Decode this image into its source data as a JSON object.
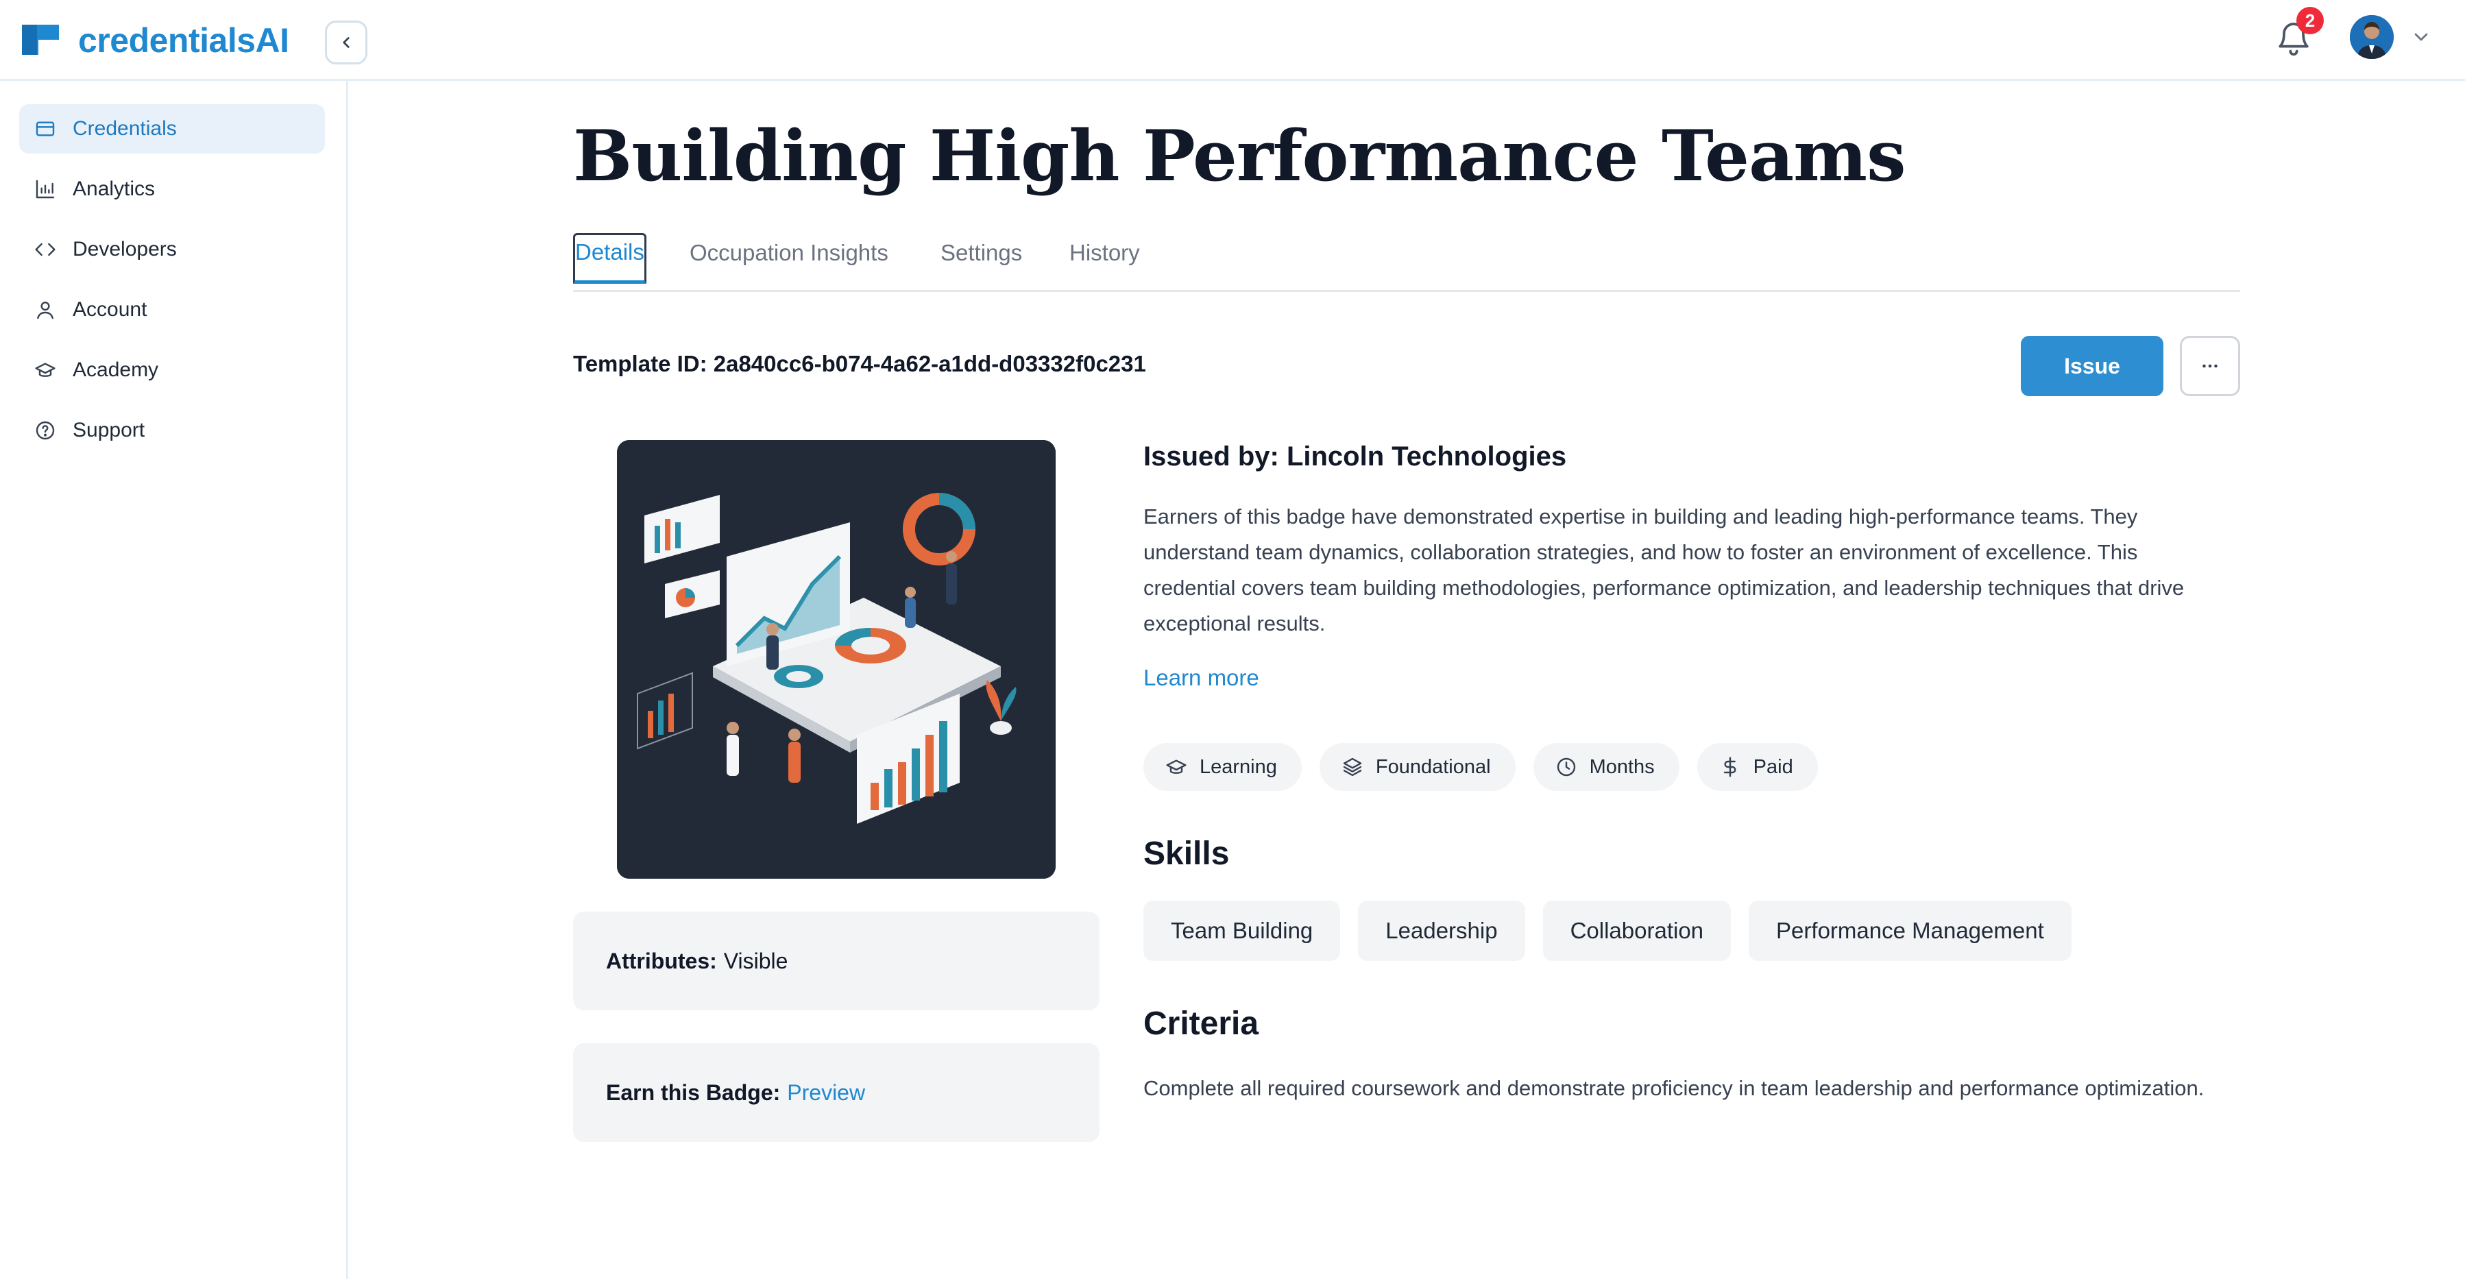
{
  "app": {
    "name": "credentialsAI",
    "notification_count": "2"
  },
  "sidebar": {
    "items": [
      {
        "label": "Credentials",
        "icon": "credit-card-icon",
        "active": true
      },
      {
        "label": "Analytics",
        "icon": "bar-chart-icon",
        "active": false
      },
      {
        "label": "Developers",
        "icon": "code-icon",
        "active": false
      },
      {
        "label": "Account",
        "icon": "user-icon",
        "active": false
      },
      {
        "label": "Academy",
        "icon": "graduation-cap-icon",
        "active": false
      },
      {
        "label": "Support",
        "icon": "help-circle-icon",
        "active": false
      }
    ]
  },
  "page": {
    "title": "Building High Performance Teams",
    "tabs": [
      {
        "label": "Details",
        "active": true
      },
      {
        "label": "Occupation Insights",
        "active": false
      },
      {
        "label": "Settings",
        "active": false
      },
      {
        "label": "History",
        "active": false
      }
    ],
    "template_id": "Template ID: 2a840cc6-b074-4a62-a1dd-d03332f0c231",
    "issue_label": "Issue"
  },
  "cards": {
    "attributes_key": "Attributes:",
    "attributes_value": "Visible",
    "earn_key": "Earn this Badge:",
    "earn_link": "Preview"
  },
  "details": {
    "issued_by": "Issued by: Lincoln Technologies",
    "description": "Earners of this badge have demonstrated expertise in building and leading high-performance teams. They understand team dynamics, collaboration strategies, and how to foster an environment of excellence. This credential covers team building methodologies, performance optimization, and leadership techniques that drive exceptional results.",
    "learn_more": "Learn more",
    "meta_tags": [
      {
        "label": "Learning",
        "icon": "graduation-cap-icon"
      },
      {
        "label": "Foundational",
        "icon": "layers-icon"
      },
      {
        "label": "Months",
        "icon": "clock-icon"
      },
      {
        "label": "Paid",
        "icon": "dollar-icon"
      }
    ],
    "skills_heading": "Skills",
    "skills": [
      "Team Building",
      "Leadership",
      "Collaboration",
      "Performance Management"
    ],
    "criteria_heading": "Criteria",
    "criteria_text": "Complete all required coursework and demonstrate proficiency in team leadership and performance optimization."
  },
  "colors": {
    "accent": "#1e88d0",
    "issue_button": "#2d8fd1",
    "active_nav_bg": "#e8f1fa",
    "notification_badge": "#ef2b3a",
    "badge_art_bg": "#222a38"
  }
}
